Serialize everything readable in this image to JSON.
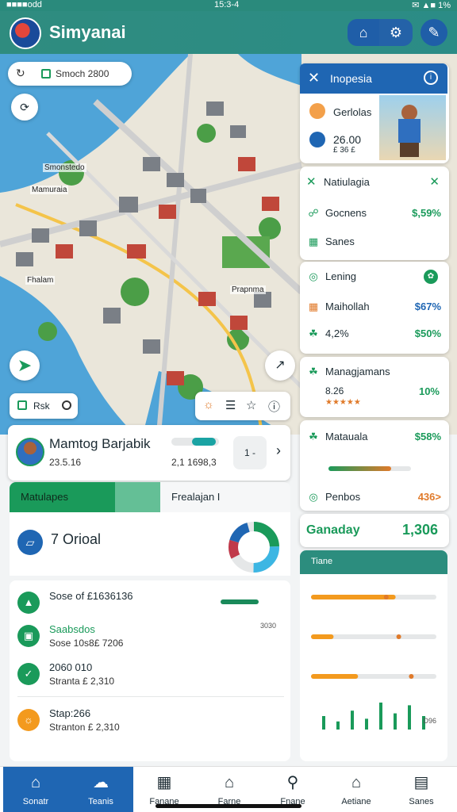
{
  "status": {
    "left": "■■■■odd",
    "center": "15:3-4",
    "right": "✉ ▲■ 1%"
  },
  "app": {
    "title": "Simyanai"
  },
  "header_icons": [
    "home-outline-icon",
    "gear-icon",
    "edit-icon"
  ],
  "map": {
    "search_chip": "Smoch 2800  ",
    "labels": [
      "Smonstedo",
      "Mamuraia",
      "Fhalam",
      "Prapnma"
    ],
    "chip": "Rsk"
  },
  "side_panel": {
    "title": "Inopesia",
    "card1": {
      "title": "Gerlolas",
      "value": "26.00",
      "sub": "£ 36 £"
    },
    "section_title": "Natiulagia",
    "rows": [
      {
        "label": "Gocnens",
        "value": "$,59%"
      },
      {
        "label": "Sanes",
        "value": ""
      },
      {
        "label": "Lening",
        "value": ""
      }
    ],
    "block2": [
      {
        "label": "Maihollah",
        "value": "$67%"
      },
      {
        "label": "4,2%",
        "value": "$50%"
      }
    ],
    "block3": {
      "title": "Managjamans",
      "value": "10%",
      "sub": "8.26"
    },
    "block4": [
      {
        "label": "Matauala",
        "value": "$58%"
      },
      {
        "label": "Penbos",
        "value": "436>"
      }
    ]
  },
  "profile": {
    "name": "Mamtog Barjabik",
    "sub": "23.5.16",
    "sub2": "2,1 1698,3",
    "page": "1 -"
  },
  "tabs": [
    "Matulapes",
    "Frealajan I"
  ],
  "summary": {
    "label": "7 Orioal"
  },
  "list": [
    {
      "title": "Sose of £1636136",
      "sub": "",
      "num": ""
    },
    {
      "title": "Saabsdos",
      "sub": "Sose 10s8£ 7206",
      "num": "3030"
    },
    {
      "title": "2060 010",
      "sub": "Stranta £ 2,310",
      "num": ""
    },
    {
      "title": "Stap:266",
      "sub": "Stranton £ 2,310",
      "num": ""
    }
  ],
  "totals": {
    "label": "Ganaday",
    "value": "1,306"
  },
  "chart": {
    "title": "Tiane",
    "bars": [
      0.45,
      0.12,
      0.25
    ],
    "sparks": [
      0.5,
      0.3,
      0.7,
      0.4,
      1.0,
      0.6,
      0.9,
      0.5
    ],
    "footer": "D96"
  },
  "nav": [
    {
      "label": "Sonatr",
      "icon": "home-icon"
    },
    {
      "label": "Teanis",
      "icon": "chat-icon"
    },
    {
      "label": "Fanane",
      "icon": "calendar-icon"
    },
    {
      "label": "Farne",
      "icon": "house-icon"
    },
    {
      "label": "Fnane",
      "icon": "search-icon"
    },
    {
      "label": "Aetiane",
      "icon": "house-icon"
    },
    {
      "label": "Sanes",
      "icon": "card-icon"
    }
  ]
}
